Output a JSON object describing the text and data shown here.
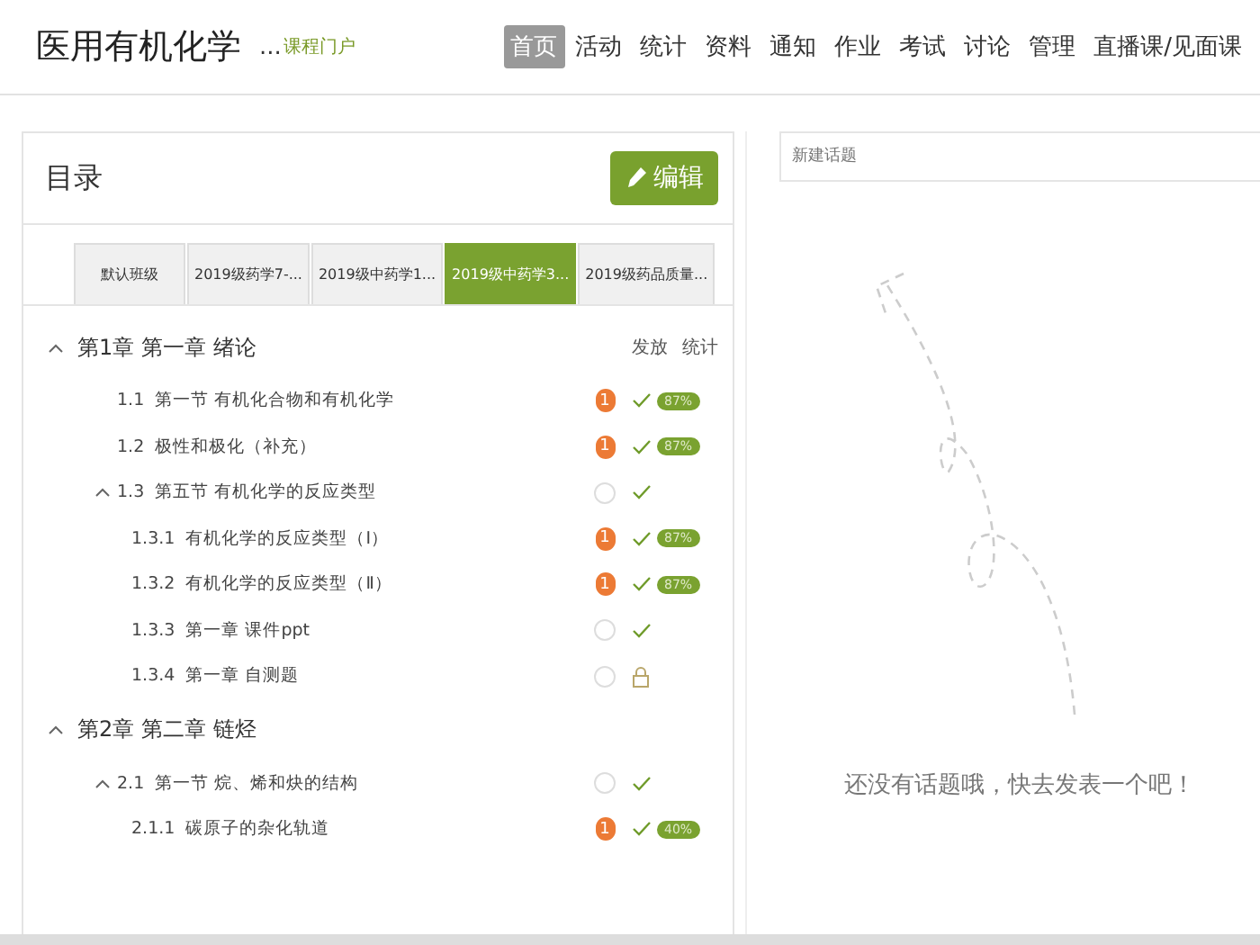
{
  "header": {
    "course_title": "医用有机化学",
    "ellipsis": "...",
    "portal_link": "课程门户",
    "nav": [
      {
        "label": "首页",
        "selected": true
      },
      {
        "label": "活动",
        "selected": false
      },
      {
        "label": "统计",
        "selected": false
      },
      {
        "label": "资料",
        "selected": false
      },
      {
        "label": "通知",
        "selected": false
      },
      {
        "label": "作业",
        "selected": false
      },
      {
        "label": "考试",
        "selected": false
      },
      {
        "label": "讨论",
        "selected": false
      },
      {
        "label": "管理",
        "selected": false
      },
      {
        "label": "直播课/见面课",
        "selected": false
      }
    ]
  },
  "catalog": {
    "title": "目录",
    "edit_button": "编辑",
    "class_tabs": [
      {
        "label": "默认班级",
        "selected": false
      },
      {
        "label": "2019级药学7-...",
        "selected": false
      },
      {
        "label": "2019级中药学1...",
        "selected": false
      },
      {
        "label": "2019级中药学3...",
        "selected": true
      },
      {
        "label": "2019级药品质量...",
        "selected": false
      }
    ],
    "column_headers": [
      "发放",
      "统计"
    ],
    "chapters": [
      {
        "title": "第1章 第一章 绪论",
        "expanded": true,
        "children": [
          {
            "number": "1.1",
            "title": "第一节 有机化合物和有机化学",
            "badge": "1",
            "locked": false,
            "stat": "87%"
          },
          {
            "number": "1.2",
            "title": "极性和极化（补充）",
            "badge": "1",
            "locked": false,
            "stat": "87%"
          },
          {
            "number": "1.3",
            "title": "第五节 有机化学的反应类型",
            "expanded": true,
            "locked": false,
            "children": [
              {
                "number": "1.3.1",
                "title": "有机化学的反应类型（Ⅰ）",
                "badge": "1",
                "locked": false,
                "stat": "87%"
              },
              {
                "number": "1.3.2",
                "title": "有机化学的反应类型（Ⅱ）",
                "badge": "1",
                "locked": false,
                "stat": "87%"
              },
              {
                "number": "1.3.3",
                "title": "第一章 课件ppt",
                "locked": false
              },
              {
                "number": "1.3.4",
                "title": "第一章 自测题",
                "locked": true
              }
            ]
          }
        ]
      },
      {
        "title": "第2章 第二章 链烃",
        "expanded": true,
        "children": [
          {
            "number": "2.1",
            "title": "第一节 烷、烯和炔的结构",
            "expanded": true,
            "locked": false,
            "children": [
              {
                "number": "2.1.1",
                "title": "碳原子的杂化轨道",
                "badge": "1",
                "locked": false,
                "stat": "40%"
              }
            ]
          }
        ]
      }
    ]
  },
  "discussion": {
    "new_topic": {
      "placeholder": "新建话题"
    },
    "empty_message": "还没有话题哦，快去发表一个吧！"
  }
}
